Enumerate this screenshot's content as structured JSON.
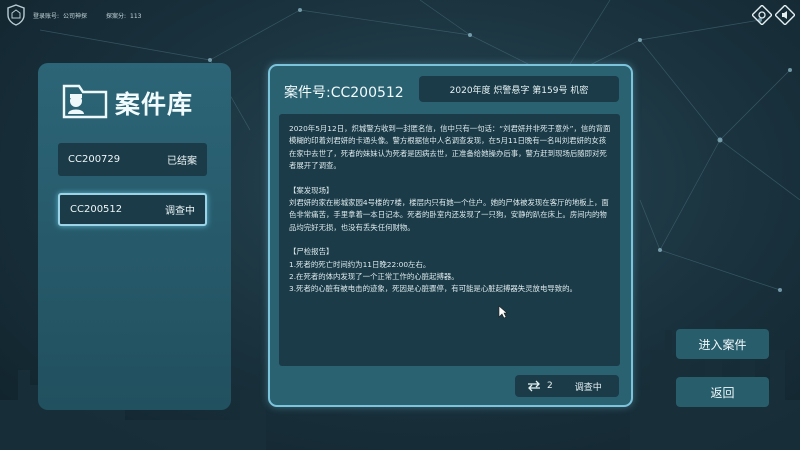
{
  "topbar": {
    "account_label": "登录账号:",
    "account_value": "公司神探",
    "score_label": "探案分:",
    "score_value": "113"
  },
  "library": {
    "title": "案件库",
    "cases": [
      {
        "id": "CC200729",
        "status": "已结案"
      },
      {
        "id": "CC200512",
        "status": "调查中"
      }
    ]
  },
  "detail": {
    "case_no": "案件号:CC200512",
    "tag": "2020年度  炽警悬字 第159号  机密",
    "paragraphs": [
      "2020年5月12日，炽城警方收到一封匿名信，信中只有一句话：“刘君妍并非死于意外”，信的背面模糊的印着刘君妍的卡通头像。警方根据信中人名调查发现，在5月11日晚有一名叫刘君妍的女孩在家中去世了，死者的妹妹认为死者是因病去世，正准备给她操办后事，警方赶到现场后随即对死者展开了调查。",
      "【案发现场】",
      "刘君妍的家在彬城家园4号楼的7楼，楼层内只有她一个住户。她的尸体被发现在客厅的地板上，面色非常痛苦，手里拿着一本日记本。死者的卧室内还发现了一只狗，安静的趴在床上。房间内的物品均完好无损，也没有丢失任何财物。",
      "【尸检报告】",
      "1.死者的死亡时间约为11日晚22:00左右。",
      "2.在死者的体内发现了一个正常工作的心脏起搏器。",
      "3.死者的心脏有被电击的迹象，死因是心脏骤停，有可能是心脏起搏器失灵放电导致的。"
    ],
    "count": "2",
    "status": "调查中"
  },
  "buttons": {
    "enter": "进入案件",
    "back": "返回"
  }
}
